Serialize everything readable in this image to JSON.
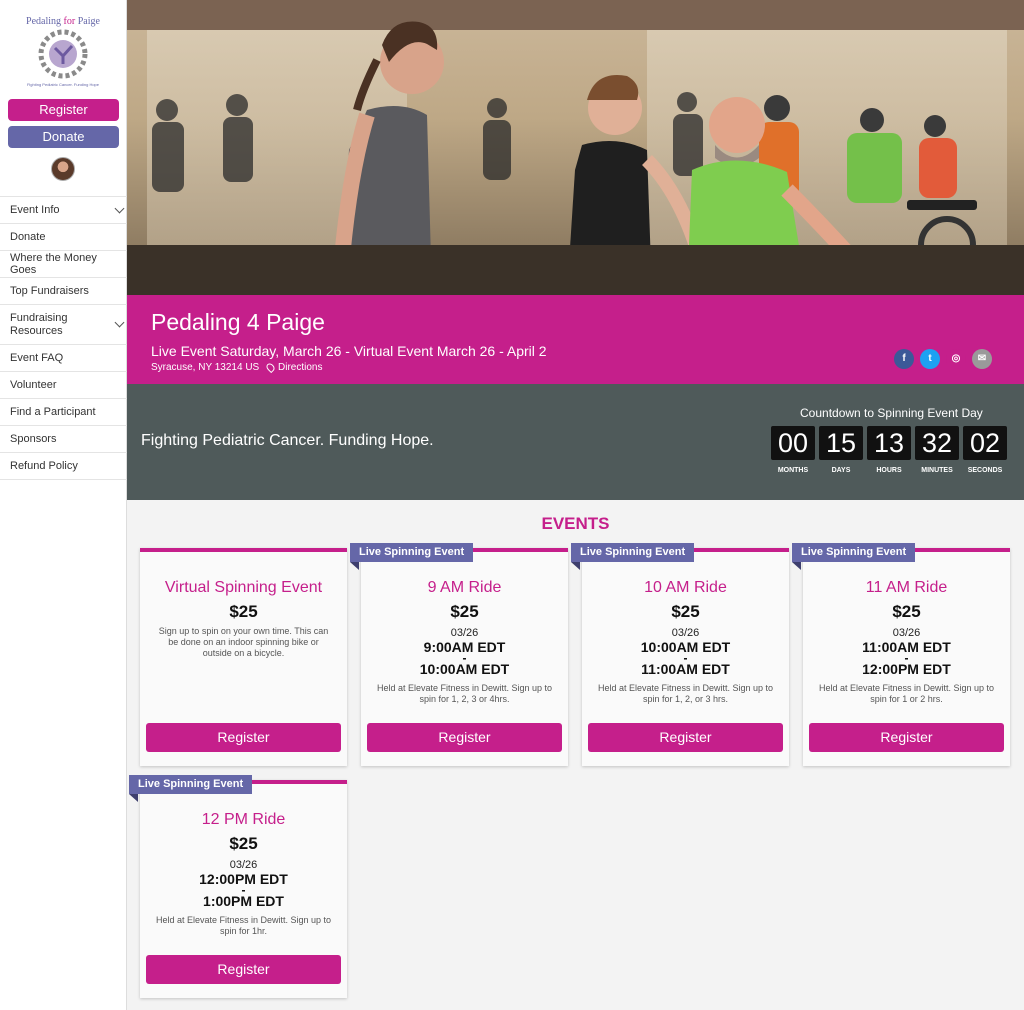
{
  "sidebar": {
    "logo_text": "Pedaling for Paige",
    "logo_tagline": "Fighting Pediatric Cancer. Funding Hope",
    "register_label": "Register",
    "donate_label": "Donate",
    "nav": [
      {
        "label": "Event Info",
        "has_children": true
      },
      {
        "label": "Donate",
        "has_children": false
      },
      {
        "label": "Where the Money Goes",
        "has_children": false
      },
      {
        "label": "Top Fundraisers",
        "has_children": false
      },
      {
        "label": "Fundraising Resources",
        "has_children": true
      },
      {
        "label": "Event FAQ",
        "has_children": false
      },
      {
        "label": "Volunteer",
        "has_children": false
      },
      {
        "label": "Find a Participant",
        "has_children": false
      },
      {
        "label": "Sponsors",
        "has_children": false
      },
      {
        "label": "Refund Policy",
        "has_children": false
      }
    ]
  },
  "banner": {
    "title": "Pedaling 4 Paige",
    "subtitle": "Live Event Saturday, March 26 - Virtual Event March 26 - April 2",
    "location": "Syracuse, NY 13214 US",
    "directions_label": "Directions",
    "social": [
      {
        "icon": "facebook-icon",
        "glyph": "f",
        "color": "#3b5998"
      },
      {
        "icon": "twitter-icon",
        "glyph": "t",
        "color": "#1da1f2"
      },
      {
        "icon": "instagram-icon",
        "glyph": "◎",
        "color": "#c51f8b"
      },
      {
        "icon": "email-icon",
        "glyph": "✉",
        "color": "#9a9a9a"
      }
    ]
  },
  "countdown": {
    "tagline": "Fighting Pediatric Cancer. Funding Hope.",
    "title": "Countdown to Spinning Event Day",
    "units": [
      {
        "value": "00",
        "label": "MONTHS"
      },
      {
        "value": "15",
        "label": "DAYS"
      },
      {
        "value": "13",
        "label": "HOURS"
      },
      {
        "value": "32",
        "label": "MINUTES"
      },
      {
        "value": "02",
        "label": "SECONDS"
      }
    ]
  },
  "events": {
    "heading": "EVENTS",
    "cards": [
      {
        "ribbon": "",
        "name": "Virtual Spinning Event",
        "price": "$25",
        "date": "",
        "start": "",
        "end": "",
        "desc": "Sign up to spin on your own time. This can be done on an indoor spinning bike or outside on a bicycle.",
        "button": "Register"
      },
      {
        "ribbon": "Live Spinning Event",
        "name": "9 AM Ride",
        "price": "$25",
        "date": "03/26",
        "start": "9:00AM EDT",
        "end": "10:00AM EDT",
        "desc": "Held at Elevate Fitness in Dewitt. Sign up to spin for 1, 2, 3 or 4hrs.",
        "button": "Register"
      },
      {
        "ribbon": "Live Spinning Event",
        "name": "10 AM Ride",
        "price": "$25",
        "date": "03/26",
        "start": "10:00AM EDT",
        "end": "11:00AM EDT",
        "desc": "Held at Elevate Fitness in Dewitt. Sign up to spin for 1, 2, or 3 hrs.",
        "button": "Register"
      },
      {
        "ribbon": "Live Spinning Event",
        "name": "11 AM Ride",
        "price": "$25",
        "date": "03/26",
        "start": "11:00AM EDT",
        "end": "12:00PM EDT",
        "desc": "Held at Elevate Fitness in Dewitt. Sign up to spin for 1 or 2 hrs.",
        "button": "Register"
      },
      {
        "ribbon": "Live Spinning Event",
        "name": "12 PM Ride",
        "price": "$25",
        "date": "03/26",
        "start": "12:00PM EDT",
        "end": "1:00PM EDT",
        "desc": "Held at Elevate Fitness in Dewitt. Sign up to spin for 1hr.",
        "button": "Register"
      }
    ]
  }
}
